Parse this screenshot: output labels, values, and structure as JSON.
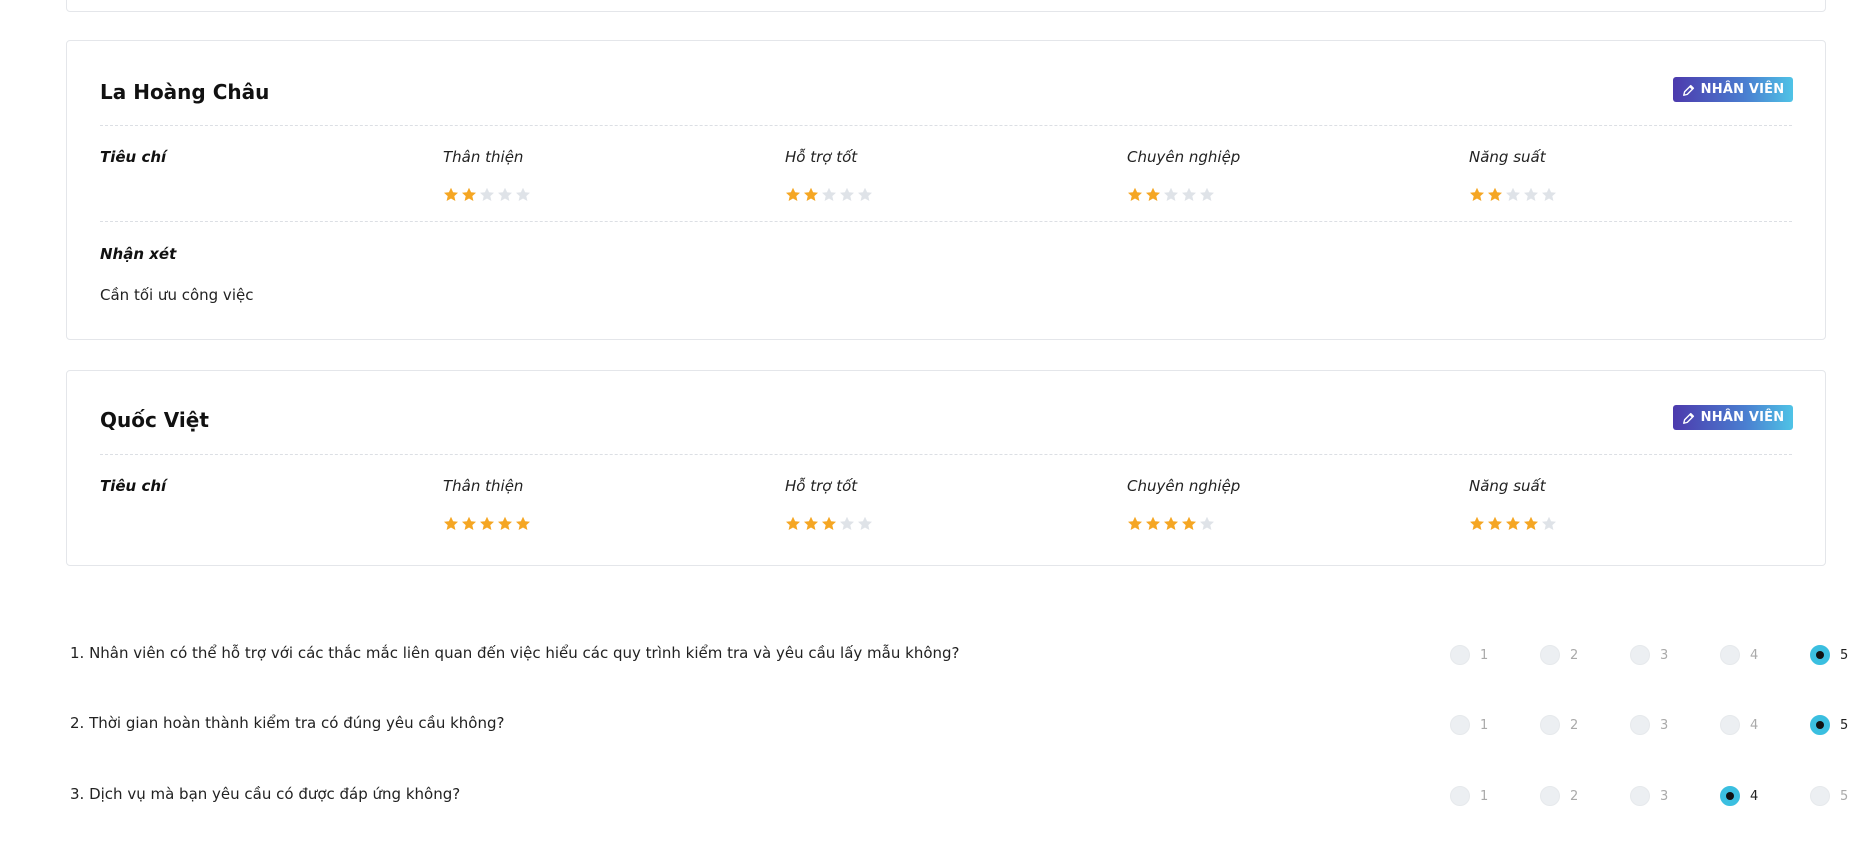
{
  "colors": {
    "accent": "#3bbfe0",
    "star_on": "#f5a623",
    "star_off": "#dfe3e8",
    "badge_start": "#4c3aad",
    "badge_end": "#4fc3e6"
  },
  "cards": [
    {
      "name": "La Hoàng Châu",
      "badge": "NHÂN VIÊN",
      "criteria_label": "Tiêu chí",
      "metrics": [
        {
          "label": "Thân thiện",
          "rating": 2
        },
        {
          "label": "Hỗ trợ tốt",
          "rating": 2
        },
        {
          "label": "Chuyên nghiệp",
          "rating": 2
        },
        {
          "label": "Năng suất",
          "rating": 2
        }
      ],
      "comment_label": "Nhận xét",
      "comment": "Cần tối ưu công việc"
    },
    {
      "name": "Quốc Việt",
      "badge": "NHÂN VIÊN",
      "criteria_label": "Tiêu chí",
      "metrics": [
        {
          "label": "Thân thiện",
          "rating": 5
        },
        {
          "label": "Hỗ trợ tốt",
          "rating": 3
        },
        {
          "label": "Chuyên nghiệp",
          "rating": 4
        },
        {
          "label": "Năng suất",
          "rating": 4
        }
      ]
    }
  ],
  "questions": [
    {
      "text": "1. Nhân viên có thể hỗ trợ với các thắc mắc liên quan đến việc hiểu các quy trình kiểm tra và yêu cầu lấy mẫu không?",
      "selected": 5
    },
    {
      "text": "2. Thời gian hoàn thành kiểm tra có đúng yêu cầu không?",
      "selected": 5
    },
    {
      "text": "3. Dịch vụ mà bạn yêu cầu có được đáp ứng không?",
      "selected": 4
    }
  ],
  "options": [
    "1",
    "2",
    "3",
    "4",
    "5"
  ],
  "icons": {
    "badge": "pen-icon",
    "rating": "star-icon"
  }
}
